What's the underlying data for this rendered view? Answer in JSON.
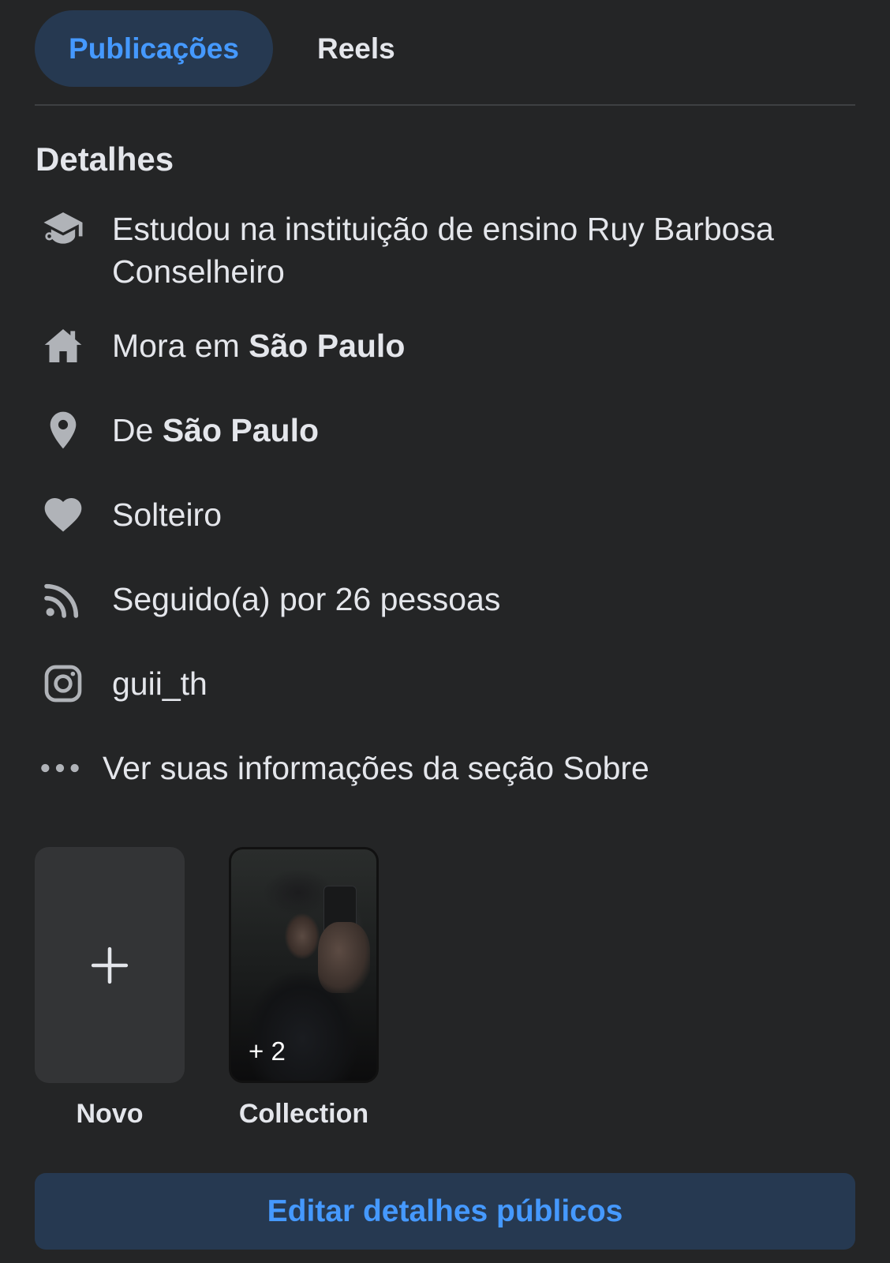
{
  "tabs": {
    "active_label": "Publicações",
    "second_label": "Reels"
  },
  "details": {
    "title": "Detalhes",
    "education": "Estudou na instituição de ensino Ruy Barbosa Conselheiro",
    "lives_prefix": "Mora em ",
    "lives_city": "São Paulo",
    "from_prefix": "De ",
    "from_city": "São Paulo",
    "relationship": "Solteiro",
    "followers": "Seguido(a) por 26 pessoas",
    "instagram": "guii_th",
    "see_more": "Ver suas informações da seção Sobre"
  },
  "icons": {
    "education": "graduation-cap-icon",
    "home": "house-icon",
    "from": "location-pin-icon",
    "relationship": "heart-icon",
    "followers": "rss-feed-icon",
    "instagram": "instagram-icon",
    "more": "ellipsis-icon",
    "new": "plus-icon"
  },
  "featured": {
    "new_label": "Novo",
    "collection_label": "Collection",
    "collection_extra": "+ 2"
  },
  "edit_button": {
    "label": "Editar detalhes públicos"
  },
  "colors": {
    "background": "#242526",
    "accent": "#4599ff",
    "accent_bg": "#263951",
    "text": "#e4e6eb",
    "icon": "#b0b3b8"
  }
}
